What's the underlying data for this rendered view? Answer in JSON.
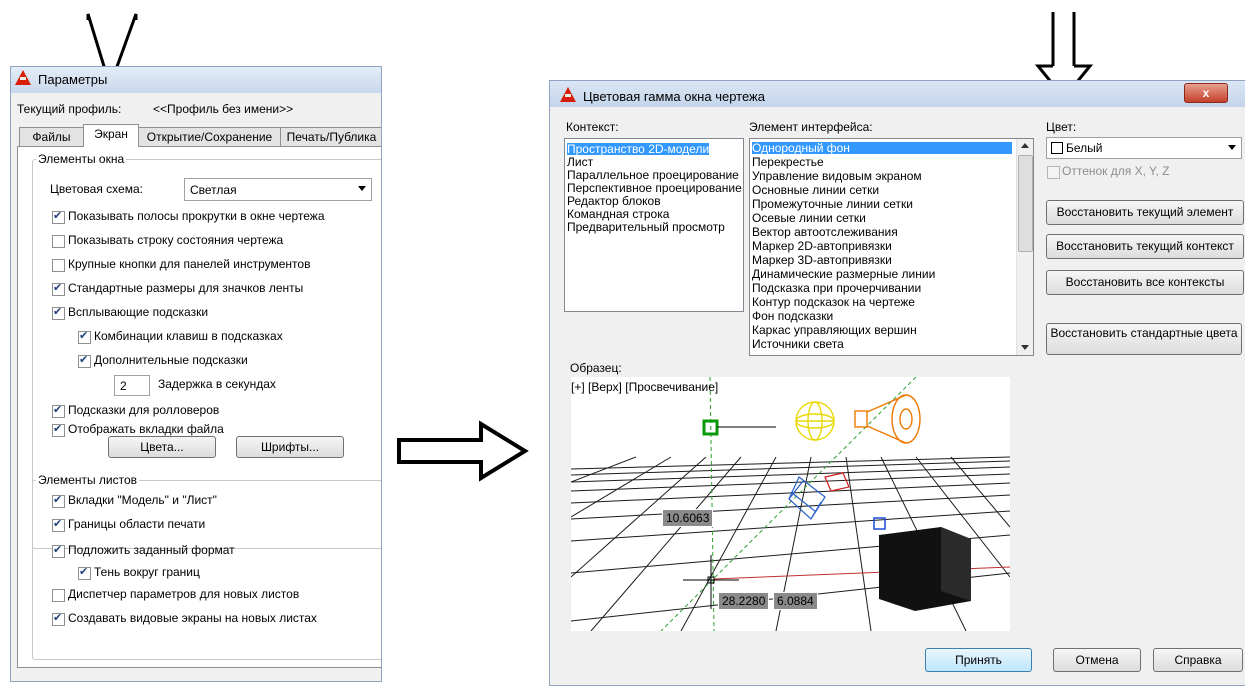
{
  "left_dialog": {
    "title": "Параметры",
    "profile_label": "Текущий профиль:",
    "profile_value": "<<Профиль без имени>>",
    "tabs": [
      "Файлы",
      "Экран",
      "Открытие/Сохранение",
      "Печать/Публика"
    ],
    "active_tab": "Экран",
    "window_elements": {
      "group_title": "Элементы окна",
      "color_scheme_label": "Цветовая схема:",
      "color_scheme_value": "Светлая",
      "checkboxes": [
        {
          "label": "Показывать полосы прокрутки в окне чертежа",
          "checked": true
        },
        {
          "label": "Показывать строку состояния чертежа",
          "checked": false
        },
        {
          "label": "Крупные кнопки для панелей инструментов",
          "checked": false
        },
        {
          "label": "Стандартные размеры для значков ленты",
          "checked": true
        },
        {
          "label": "Всплывающие подсказки",
          "checked": true
        },
        {
          "label": "Комбинации клавиш в подсказках",
          "checked": true
        },
        {
          "label": "Дополнительные подсказки",
          "checked": true
        }
      ],
      "delay_value": "2",
      "delay_label": "Задержка в секундах",
      "checkboxes2": [
        {
          "label": "Подсказки для ролловеров",
          "checked": true
        },
        {
          "label": "Отображать вкладки файла",
          "checked": true
        }
      ],
      "colors_button": "Цвета...",
      "fonts_button": "Шрифты..."
    },
    "layout_elements": {
      "group_title": "Элементы листов",
      "checkboxes": [
        {
          "label": "Вкладки \"Модель\" и \"Лист\"",
          "checked": true
        },
        {
          "label": "Границы области печати",
          "checked": true
        },
        {
          "label": "Подложить заданный формат",
          "checked": true
        },
        {
          "label": "Тень вокруг границ",
          "checked": true
        },
        {
          "label": "Диспетчер параметров для новых листов",
          "checked": false
        },
        {
          "label": "Создавать видовые экраны на новых листах",
          "checked": true
        }
      ]
    }
  },
  "right_dialog": {
    "title": "Цветовая гамма окна чертежа",
    "close_label": "x",
    "context": {
      "label": "Контекст:",
      "items": [
        "Пространство 2D-модели",
        "Лист",
        "Параллельное проецирование",
        "Перспективное проецирование",
        "Редактор блоков",
        "Командная строка",
        "Предварительный просмотр"
      ],
      "selected": 0
    },
    "interface_element": {
      "label": "Элемент интерфейса:",
      "items": [
        "Однородный фон",
        "Перекрестье",
        "Управление видовым экраном",
        "Основные линии сетки",
        "Промежуточные линии сетки",
        "Осевые линии сетки",
        "Вектор автоотслеживания",
        "Маркер 2D-автопривязки",
        "Маркер 3D-автопривязки",
        "Динамические размерные линии",
        "Подсказка при прочерчивании",
        "Контур подсказок на чертеже",
        "Фон подсказки",
        "Каркас управляющих вершин",
        "Источники света"
      ],
      "selected": 0
    },
    "color": {
      "label": "Цвет:",
      "value": "Белый",
      "tint_label": "Оттенок для X, Y, Z"
    },
    "buttons": {
      "restore_element": "Восстановить текущий элемент",
      "restore_context": "Восстановить текущий контекст",
      "restore_all": "Восстановить все контексты",
      "restore_classic": "Восстановить стандартные цвета"
    },
    "preview": {
      "label": "Образец:",
      "viewport_label": "[+] [Верх] [Просвечивание]",
      "dims": [
        "10.6063",
        "28.2280",
        "6.0884"
      ]
    },
    "footer": {
      "ok": "Принять",
      "cancel": "Отмена",
      "help": "Справка"
    }
  },
  "colors": {
    "accent_selection": "#3399ff",
    "acad_red": "#d81e05",
    "preview_bg": "#ffffff"
  }
}
